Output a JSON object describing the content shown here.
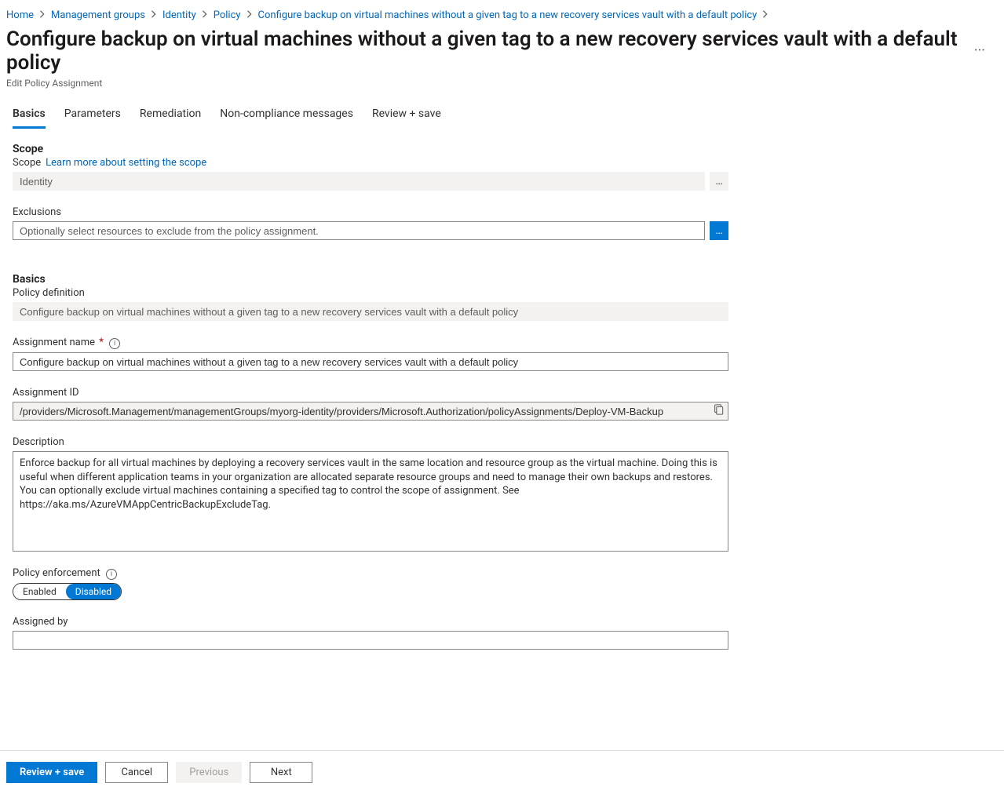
{
  "breadcrumb": [
    {
      "label": "Home"
    },
    {
      "label": "Management groups"
    },
    {
      "label": "Identity"
    },
    {
      "label": "Policy"
    },
    {
      "label": "Configure backup on virtual machines without a given tag to a new recovery services vault with a default policy"
    }
  ],
  "page": {
    "title": "Configure backup on virtual machines without a given tag to a new recovery services vault with a default policy",
    "subtitle": "Edit Policy Assignment"
  },
  "tabs": {
    "basics": "Basics",
    "parameters": "Parameters",
    "remediation": "Remediation",
    "noncompliance": "Non-compliance messages",
    "review": "Review + save"
  },
  "scope": {
    "heading": "Scope",
    "scope_label": "Scope",
    "learn_more": "Learn more about setting the scope",
    "scope_value": "Identity",
    "exclusions_label": "Exclusions",
    "exclusions_placeholder": "Optionally select resources to exclude from the policy assignment."
  },
  "basics": {
    "heading": "Basics",
    "policy_def_label": "Policy definition",
    "policy_def_value": "Configure backup on virtual machines without a given tag to a new recovery services vault with a default policy",
    "assignment_name_label": "Assignment name",
    "assignment_name_value": "Configure backup on virtual machines without a given tag to a new recovery services vault with a default policy",
    "assignment_id_label": "Assignment ID",
    "assignment_id_value": "/providers/Microsoft.Management/managementGroups/myorg-identity/providers/Microsoft.Authorization/policyAssignments/Deploy-VM-Backup",
    "description_label": "Description",
    "description_value": "Enforce backup for all virtual machines by deploying a recovery services vault in the same location and resource group as the virtual machine. Doing this is useful when different application teams in your organization are allocated separate resource groups and need to manage their own backups and restores. You can optionally exclude virtual machines containing a specified tag to control the scope of assignment. See https://aka.ms/AzureVMAppCentricBackupExcludeTag.",
    "policy_enforcement_label": "Policy enforcement",
    "enforcement_enabled": "Enabled",
    "enforcement_disabled": "Disabled",
    "assigned_by_label": "Assigned by",
    "assigned_by_value": ""
  },
  "footer": {
    "review": "Review + save",
    "cancel": "Cancel",
    "previous": "Previous",
    "next": "Next"
  }
}
